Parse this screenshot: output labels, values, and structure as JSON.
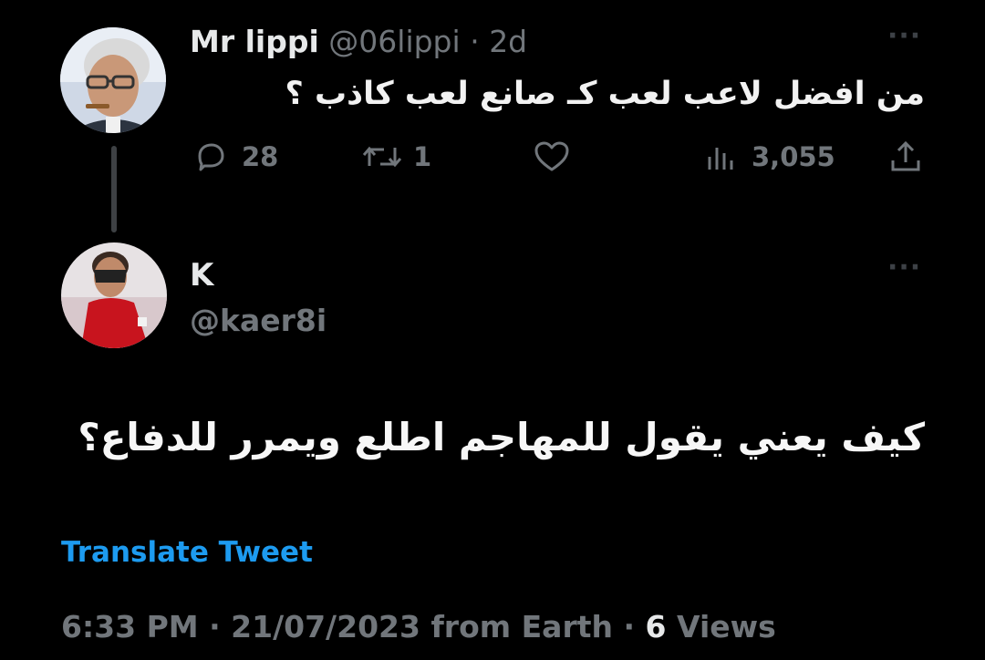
{
  "parent_tweet": {
    "display_name": "Mr lippi",
    "handle": "@06lippi",
    "separator": "·",
    "age": "2d",
    "text": "من افضل لاعب لعب كـ صانع لعب كاذب ؟",
    "actions": {
      "reply_count": "28",
      "retweet_count": "1",
      "like_count": "",
      "view_count": "3,055"
    },
    "more_glyph": "···"
  },
  "reply_tweet": {
    "display_name": "K",
    "handle": "@kaer8i",
    "text": "كيف يعني يقول للمهاجم اطلع ويمرر للدفاع؟",
    "translate_label": "Translate Tweet",
    "time": "6:33 PM",
    "date": "21/07/2023",
    "source": "from Earth",
    "separator": "·",
    "views_count": "6",
    "views_label": "Views",
    "more_glyph": "···"
  },
  "icons": {
    "reply": "comment-bubble-icon",
    "retweet": "retweet-icon",
    "like": "heart-icon",
    "views": "bar-chart-icon",
    "share": "share-upload-icon",
    "more": "more-dots-icon"
  },
  "colors": {
    "background": "#000000",
    "primary_text": "#e7e9ea",
    "secondary_text": "#71767b",
    "link": "#1d9bf0",
    "thread_line": "#3e4144"
  }
}
